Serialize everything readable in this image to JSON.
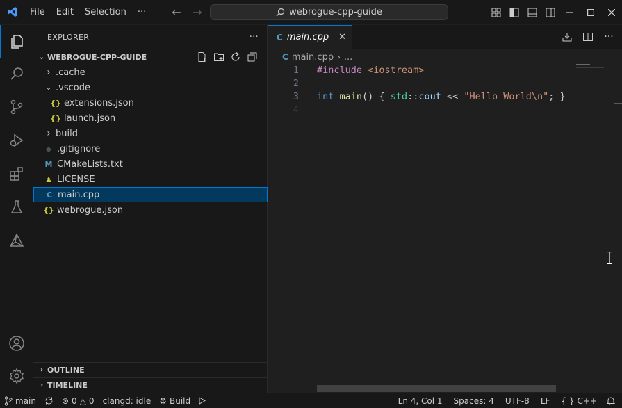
{
  "titlebar": {
    "menu": [
      "File",
      "Edit",
      "Selection",
      "···"
    ],
    "search_text": "webrogue-cpp-guide"
  },
  "explorer": {
    "header": "EXPLORER",
    "more": "···",
    "project": "WEBROGUE-CPP-GUIDE",
    "items": [
      {
        "label": ".cache",
        "kind": "folder-collapsed",
        "depth": 1
      },
      {
        "label": ".vscode",
        "kind": "folder-expanded",
        "depth": 1
      },
      {
        "label": "extensions.json",
        "kind": "json",
        "depth": 2
      },
      {
        "label": "launch.json",
        "kind": "json",
        "depth": 2
      },
      {
        "label": "build",
        "kind": "folder-collapsed",
        "depth": 1
      },
      {
        "label": ".gitignore",
        "kind": "git",
        "depth": 1
      },
      {
        "label": "CMakeLists.txt",
        "kind": "cmake",
        "depth": 1
      },
      {
        "label": "LICENSE",
        "kind": "license",
        "depth": 1
      },
      {
        "label": "main.cpp",
        "kind": "cpp",
        "depth": 1,
        "selected": true
      },
      {
        "label": "webrogue.json",
        "kind": "json",
        "depth": 1
      }
    ],
    "outline": "OUTLINE",
    "timeline": "TIMELINE"
  },
  "editor": {
    "tab_label": "main.cpp",
    "breadcrumb_file": "main.cpp",
    "breadcrumb_more": "...",
    "lines": [
      {
        "num": "1"
      },
      {
        "num": "2"
      },
      {
        "num": "3"
      },
      {
        "num": "4"
      }
    ],
    "code": {
      "l1_pp": "#include ",
      "l1_inc": "<iostream>",
      "l3_kw": "int",
      "l3_sp": " ",
      "l3_fn": "main",
      "l3_p1": "() { ",
      "l3_ns": "std",
      "l3_sep": "::",
      "l3_var": "cout",
      "l3_op": " << ",
      "l3_str": "\"Hello World\\n\"",
      "l3_end": "; }"
    }
  },
  "statusbar": {
    "branch": "main",
    "errors": "0",
    "warnings": "0",
    "clangd": "clangd: idle",
    "build": "Build",
    "position": "Ln 4, Col 1",
    "spaces": "Spaces: 4",
    "encoding": "UTF-8",
    "eol": "LF",
    "language_brackets": "{ }",
    "language": "C++"
  },
  "colors": {
    "accent": "#0078d4",
    "selection": "#04395e",
    "cpp_icon": "#519aba",
    "json_icon": "#cbcb41",
    "cmake_icon": "#6d8086"
  }
}
